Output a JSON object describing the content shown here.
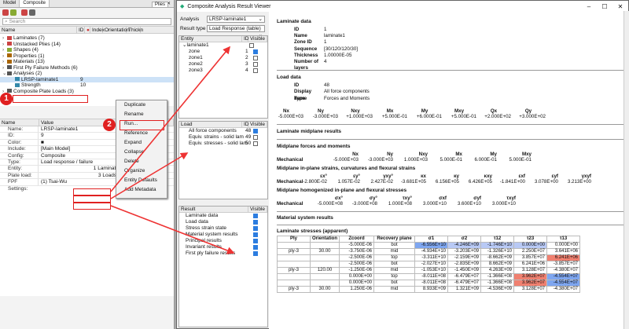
{
  "left": {
    "tabs": [
      "Model",
      "Composite"
    ],
    "search_placeholder": "Search",
    "pies_tab": "Plies",
    "columns": [
      "Name",
      "ID",
      "Index",
      "Orientation",
      "Thickn"
    ],
    "tree": [
      {
        "label": "Laminates (7)",
        "indent": 0,
        "arrow": "›",
        "icon": "#c44"
      },
      {
        "label": "Unstacked Plies (14)",
        "indent": 0,
        "arrow": "›",
        "icon": "#c44"
      },
      {
        "label": "Shapes (4)",
        "indent": 0,
        "arrow": "›",
        "icon": "#8a3"
      },
      {
        "label": "Properties (1)",
        "indent": 0,
        "arrow": "›",
        "icon": "#a60"
      },
      {
        "label": "Materials (13)",
        "indent": 0,
        "arrow": "›",
        "icon": "#a60"
      },
      {
        "label": "First Ply Failure Methods (6)",
        "indent": 0,
        "arrow": "›",
        "icon": "#555"
      },
      {
        "label": "Analyses (2)",
        "indent": 0,
        "arrow": "⌄",
        "icon": "#555"
      },
      {
        "label": "LRSP-laminate1",
        "id": "9",
        "indent": 1,
        "arrow": "",
        "icon": "#38a",
        "selected": true
      },
      {
        "label": "Strength",
        "id": "10",
        "indent": 1,
        "arrow": "",
        "icon": "#38a"
      },
      {
        "label": "Composite Plate Loads (3)",
        "indent": 0,
        "arrow": "›",
        "icon": "#555"
      }
    ],
    "prop_cols": [
      "Name",
      "Value"
    ],
    "props": [
      {
        "k": "Name:",
        "v": "LRSP-laminate1"
      },
      {
        "k": "ID:",
        "v": "9"
      },
      {
        "k": "Color:",
        "v": "■"
      },
      {
        "k": "Include:",
        "v": "[Main Model]"
      },
      {
        "k": "Config:",
        "v": "Composite"
      },
      {
        "k": "Type:",
        "v": "Load response / failure"
      },
      {
        "k": "Entity:",
        "v": "1 Laminates"
      },
      {
        "k": "Plate load:",
        "v": "3 Loads"
      },
      {
        "k": "FPF Settings:",
        "v": "(1) Tsai-Wu"
      }
    ],
    "context_menu": [
      "Duplicate",
      "Rename",
      "Run...",
      "Reference",
      "Expand",
      "Collapse",
      "Delete",
      "Organize",
      "Entity Defaults",
      "Add Metadata"
    ],
    "ctx_shortcuts": [
      "F2",
      "Del"
    ],
    "badges": [
      "1",
      "2"
    ]
  },
  "win": {
    "title": "Composite Analysis Result Viewer",
    "analysis_label": "Analysis",
    "analysis_value": "LRSP-laminate1",
    "rtype_label": "Result type",
    "rtype_value": "Load Response (table)",
    "entity_cols": [
      "Entity",
      "ID",
      "Visible"
    ],
    "entities": [
      {
        "n": "laminate1",
        "id": "",
        "on": false,
        "ind": 0,
        "arrow": "⌄"
      },
      {
        "n": "zone",
        "id": "1",
        "on": true,
        "ind": 1
      },
      {
        "n": "zone1",
        "id": "2",
        "on": false,
        "ind": 1
      },
      {
        "n": "zone2",
        "id": "3",
        "on": false,
        "ind": 1
      },
      {
        "n": "zone3",
        "id": "4",
        "on": false,
        "ind": 1
      }
    ],
    "load_cols": [
      "Load",
      "ID",
      "Visible"
    ],
    "loads": [
      {
        "n": "All force components",
        "id": "48",
        "on": true
      },
      {
        "n": "Equiv. strains - solid lam",
        "id": "49",
        "on": false
      },
      {
        "n": "Equiv. stresses - solid lam",
        "id": "50",
        "on": false
      }
    ],
    "result_cols": [
      "Result",
      "Visible"
    ],
    "results": [
      "Laminate data",
      "Load data",
      "Stress strain state",
      "Material system results",
      "Principal results",
      "Invariant results",
      "First ply failure results"
    ]
  },
  "report": {
    "laminate_h": "Laminate data",
    "laminate": [
      [
        "ID",
        "1"
      ],
      [
        "Name",
        "laminate1"
      ],
      [
        "Zone ID",
        "1"
      ],
      [
        "Sequence",
        "[30/120/120/30]"
      ],
      [
        "Thickness",
        "1.00000E-05"
      ],
      [
        "Number of layers",
        "4"
      ]
    ],
    "load_h": "Load data",
    "load": [
      [
        "ID",
        "48"
      ],
      [
        "Display name",
        "All force components"
      ],
      [
        "Type",
        "Forces and Moments"
      ]
    ],
    "force_hdr": [
      "Nx",
      "Ny",
      "Nxy",
      "Mx",
      "My",
      "Mxy",
      "Qx",
      "Qy"
    ],
    "force_vals": [
      "-5.000E+03",
      "-3.000E+03",
      "+1.000E+03",
      "+5.000E-01",
      "+6.000E-01",
      "+5.000E-01",
      "+2.000E+02",
      "+3.000E+02"
    ],
    "midplane_h": "Laminate midplane results",
    "mf_h": "Midplane forces and moments",
    "mf_hdr": [
      "Nx",
      "Ny",
      "Nxy",
      "Mx",
      "My",
      "Mxy"
    ],
    "mf_label": "Mechanical",
    "mf_vals": [
      "-5.000E+03",
      "-3.000E+03",
      "1.000E+03",
      "5.000E-01",
      "6.000E-01",
      "5.000E-01"
    ],
    "ms_h": "Midplane in-plane strains, curvatures and flexural strains",
    "ms_hdr": [
      "εx°",
      "εy°",
      "γxy°",
      "κx",
      "κy",
      "κxy",
      "εxf",
      "εyf",
      "γxyf"
    ],
    "ms_vals": [
      "-2.800E-02",
      "1.057E-02",
      "2.427E-02",
      "-3.681E+05",
      "6.156E+05",
      "6.426E+05",
      "-1.841E+00",
      "3.078E+00",
      "3.213E+00"
    ],
    "mh_h": "Midplane homogenized in-plane and flexural stresses",
    "mh_hdr": [
      "σx°",
      "σy°",
      "τxy°",
      "σxf",
      "σyf",
      "τxyf"
    ],
    "mh_vals": [
      "-5.000E+08",
      "-3.000E+08",
      "1.000E+08",
      "3.000E+10",
      "3.600E+10",
      "3.000E+10"
    ],
    "mat_h": "Material system results",
    "ls_h": "Laminate stresses (apparent)",
    "ls_hdr": [
      "Ply",
      "Orientation",
      "Zcoord",
      "Recovery plane",
      "σ1",
      "σ2",
      "τ12",
      "τ23",
      "τ13"
    ],
    "ls_rows": [
      [
        "",
        "",
        "-5.000E-06",
        "bot",
        "-6.556E+10",
        "-4.246E+09",
        "-1.746E+10",
        "0.000E+00",
        "0.000E+00"
      ],
      [
        "ply-3",
        "30.00",
        "-3.750E-06",
        "mid",
        "-4.934E+10",
        "-3.203E+09",
        "-1.326E+10",
        "2.250E+07",
        "3.641E+06"
      ],
      [
        "",
        "",
        "-2.500E-06",
        "top",
        "-3.311E+10",
        "-2.159E+09",
        "-8.662E+09",
        "3.857E+07",
        "6.241E+06"
      ],
      [
        "",
        "",
        "-2.500E-06",
        "bot",
        "-2.027E+10",
        "-2.835E+09",
        "8.662E+09",
        "6.241E+06",
        "-3.857E+07"
      ],
      [
        "ply-3",
        "120.00",
        "-1.250E-06",
        "mid",
        "-1.053E+10",
        "-1.450E+09",
        "4.263E+09",
        "3.128E+07",
        "-4.380E+07"
      ],
      [
        "",
        "",
        "0.000E+00",
        "top",
        "-8.011E+08",
        "-6.479E+07",
        "-1.366E+08",
        "3.962E+07",
        "-4.554E+07"
      ],
      [
        "",
        "",
        "0.000E+00",
        "bot",
        "-8.011E+08",
        "-6.479E+07",
        "-1.366E+08",
        "3.962E+07",
        "-4.554E+07"
      ],
      [
        "ply-3",
        "30.00",
        "1.250E-06",
        "mid",
        "8.933E+09",
        "1.321E+09",
        "-4.536E+09",
        "3.128E+07",
        "-4.380E+07"
      ]
    ]
  }
}
